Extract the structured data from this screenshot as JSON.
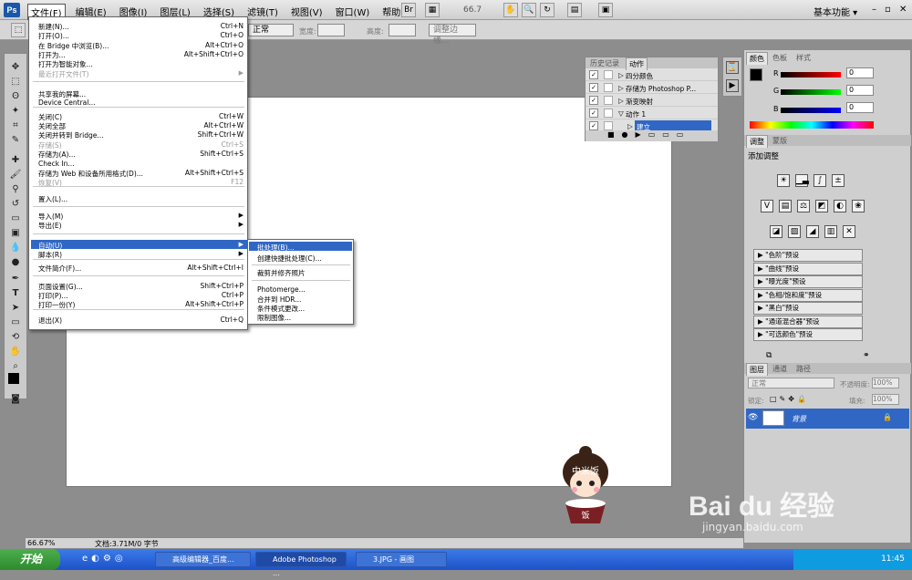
{
  "app": {
    "logo": "Ps",
    "menus": [
      "文件(F)",
      "编辑(E)",
      "图像(I)",
      "图层(L)",
      "选择(S)",
      "滤镜(T)",
      "视图(V)",
      "窗口(W)",
      "帮助(H)"
    ],
    "zoom": "66.7",
    "workspace": "基本功能 ▾"
  },
  "options": {
    "style": "正常",
    "width": "宽度:",
    "height": "高度:",
    "refine": "调整边缘..."
  },
  "file_menu": {
    "items": [
      {
        "label": "新建(N)...",
        "shortcut": "Ctrl+N"
      },
      {
        "label": "打开(O)...",
        "shortcut": "Ctrl+O"
      },
      {
        "label": "在 Bridge 中浏览(B)...",
        "shortcut": "Alt+Ctrl+O"
      },
      {
        "label": "打开为...",
        "shortcut": "Alt+Shift+Ctrl+O"
      },
      {
        "label": "打开为智能对象...",
        "shortcut": ""
      },
      {
        "label": "最近打开文件(T)",
        "shortcut": "",
        "disabled": true
      },
      {
        "label": "共享我的屏幕...",
        "shortcut": ""
      },
      {
        "label": "Device Central...",
        "shortcut": ""
      },
      {
        "label": "关闭(C)",
        "shortcut": "Ctrl+W"
      },
      {
        "label": "关闭全部",
        "shortcut": "Alt+Ctrl+W"
      },
      {
        "label": "关闭并转到 Bridge...",
        "shortcut": "Shift+Ctrl+W"
      },
      {
        "label": "存储(S)",
        "shortcut": "Ctrl+S",
        "disabled": true
      },
      {
        "label": "存储为(A)...",
        "shortcut": "Shift+Ctrl+S"
      },
      {
        "label": "Check In...",
        "shortcut": ""
      },
      {
        "label": "存储为 Web 和设备所用格式(D)...",
        "shortcut": "Alt+Shift+Ctrl+S"
      },
      {
        "label": "恢复(V)",
        "shortcut": "F12",
        "disabled": true
      },
      {
        "label": "置入(L)...",
        "shortcut": ""
      },
      {
        "label": "导入(M)",
        "shortcut": ""
      },
      {
        "label": "导出(E)",
        "shortcut": ""
      },
      {
        "label": "自动(U)",
        "shortcut": ""
      },
      {
        "label": "脚本(R)",
        "shortcut": ""
      },
      {
        "label": "文件简介(F)...",
        "shortcut": "Alt+Shift+Ctrl+I"
      },
      {
        "label": "页面设置(G)...",
        "shortcut": "Shift+Ctrl+P"
      },
      {
        "label": "打印(P)...",
        "shortcut": "Ctrl+P"
      },
      {
        "label": "打印一份(Y)",
        "shortcut": "Alt+Shift+Ctrl+P"
      },
      {
        "label": "退出(X)",
        "shortcut": "Ctrl+Q"
      }
    ]
  },
  "auto_submenu": [
    "批处理(B)...",
    "创建快捷批处理(C)...",
    "裁剪并修齐照片",
    "Photomerge...",
    "合并到 HDR...",
    "条件模式更改...",
    "限制图像..."
  ],
  "history": {
    "tabs": [
      "历史记录",
      "动作"
    ],
    "rows": [
      "四分颜色",
      "存储为 Photoshop P...",
      "渐变映射",
      "动作 1",
      "建立"
    ]
  },
  "color_panel": {
    "tabs": [
      "颜色",
      "色板",
      "样式"
    ],
    "r": "0",
    "g": "0",
    "b": "0",
    "labels": [
      "R",
      "G",
      "B"
    ]
  },
  "adjust_panel": {
    "tabs": [
      "调整",
      "蒙版"
    ],
    "title": "添加调整",
    "presets": [
      "\"色阶\"预设",
      "\"曲线\"预设",
      "\"曝光度\"预设",
      "\"色相/饱和度\"预设",
      "\"黑白\"预设",
      "\"通道混合器\"预设",
      "\"可选颜色\"预设"
    ]
  },
  "layers_panel": {
    "tabs": [
      "图层",
      "通道",
      "路径"
    ],
    "blend": "正常",
    "opacity_label": "不透明度:",
    "opacity": "100%",
    "lock_label": "锁定:",
    "fill_label": "填充:",
    "fill": "100%",
    "layer_name": "背景"
  },
  "status": {
    "zoom": "66.67%",
    "doc": "文档:3.71M/0 字节"
  },
  "taskbar": {
    "start": "开始",
    "tasks": [
      "高级编辑器_百度...",
      "Adobe Photoshop ...",
      "3.JPG - 画图"
    ],
    "time": "11:45"
  },
  "watermark": {
    "brand": "Bai du 经验",
    "url": "jingyan.baidu.com"
  },
  "character": {
    "text": "中米饭",
    "bowl": "饭"
  }
}
